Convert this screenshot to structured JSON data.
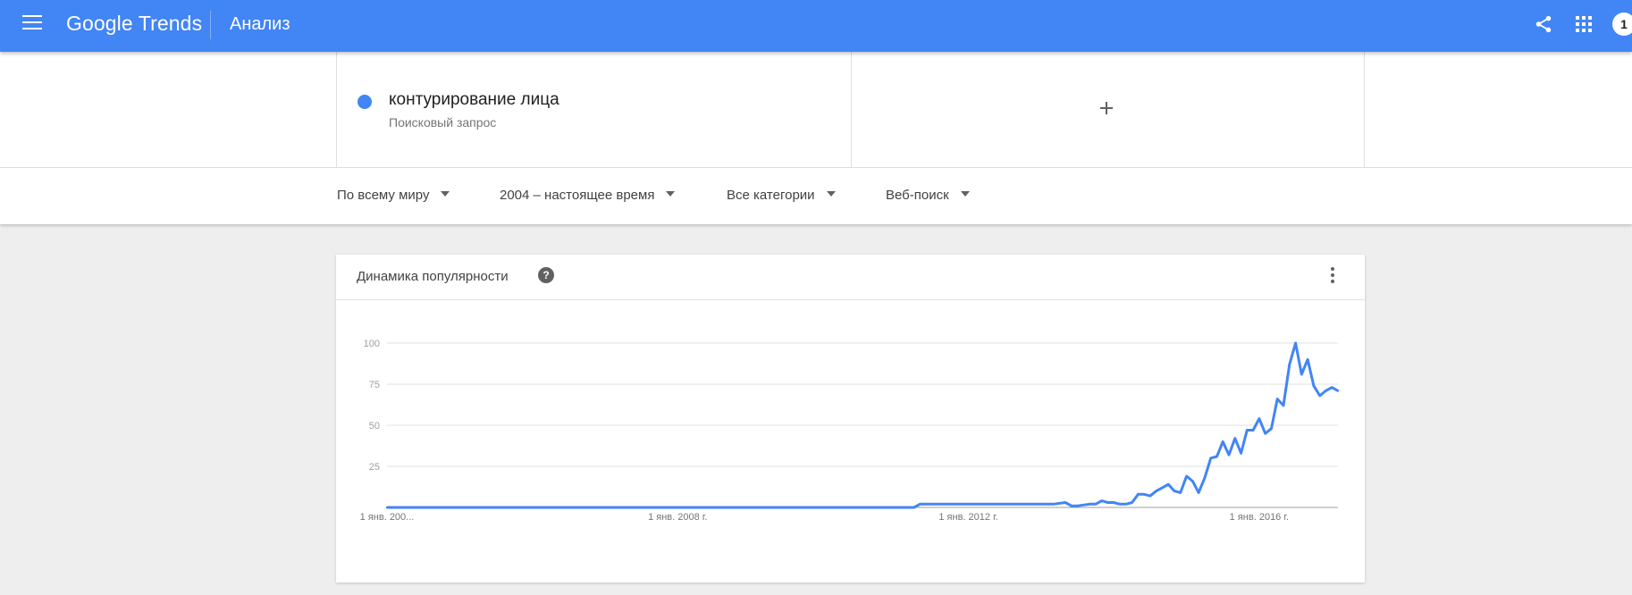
{
  "app": {
    "logo_text": "Google Trends",
    "page_title": "Анализ",
    "avatar_text": "1",
    "brand_color": "#4285f4"
  },
  "icons": {
    "menu": "menu-icon",
    "share": "share-icon",
    "apps": "apps-grid-icon",
    "add": "plus-icon",
    "help": "help-icon",
    "more": "more-vert-icon"
  },
  "terms": [
    {
      "name": "контурирование лица",
      "type": "Поисковый запрос",
      "color": "#4285f4"
    }
  ],
  "filters": {
    "region": "По всему миру",
    "period": "2004 – настоящее время",
    "category": "Все категории",
    "search_type": "Веб-поиск"
  },
  "chart_card": {
    "title": "Динамика популярности",
    "help_symbol": "?"
  },
  "chart_data": {
    "type": "line",
    "title": "Динамика популярности",
    "y_ticks": [
      "100",
      "75",
      "50",
      "25"
    ],
    "ylim": [
      0,
      100
    ],
    "x_tick_labels": [
      "1 янв. 200...",
      "1 янв. 2008 г.",
      "1 янв. 2012 г.",
      "1 янв. 2016 г."
    ],
    "x_tick_months": [
      0,
      48,
      96,
      144
    ],
    "xlim_months": [
      0,
      157
    ],
    "grid": true,
    "series": [
      {
        "color": "#4285f4",
        "points": [
          [
            0,
            0
          ],
          [
            10,
            0
          ],
          [
            20,
            0
          ],
          [
            30,
            0
          ],
          [
            40,
            0
          ],
          [
            50,
            0
          ],
          [
            60,
            0
          ],
          [
            70,
            0
          ],
          [
            80,
            0
          ],
          [
            87,
            0
          ],
          [
            88,
            2
          ],
          [
            90,
            2
          ],
          [
            95,
            2
          ],
          [
            100,
            2
          ],
          [
            105,
            2
          ],
          [
            110,
            2
          ],
          [
            112,
            3
          ],
          [
            113,
            1
          ],
          [
            114,
            1
          ],
          [
            116,
            2
          ],
          [
            117,
            2
          ],
          [
            118,
            4
          ],
          [
            119,
            3
          ],
          [
            120,
            3
          ],
          [
            121,
            2
          ],
          [
            122,
            2
          ],
          [
            123,
            3
          ],
          [
            124,
            8
          ],
          [
            125,
            8
          ],
          [
            126,
            7
          ],
          [
            127,
            10
          ],
          [
            128,
            12
          ],
          [
            129,
            14
          ],
          [
            130,
            10
          ],
          [
            131,
            9
          ],
          [
            132,
            19
          ],
          [
            133,
            16
          ],
          [
            134,
            9
          ],
          [
            135,
            18
          ],
          [
            136,
            30
          ],
          [
            137,
            31
          ],
          [
            138,
            40
          ],
          [
            139,
            32
          ],
          [
            140,
            42
          ],
          [
            141,
            33
          ],
          [
            142,
            47
          ],
          [
            143,
            47
          ],
          [
            144,
            54
          ],
          [
            145,
            45
          ],
          [
            146,
            48
          ],
          [
            147,
            66
          ],
          [
            148,
            62
          ],
          [
            149,
            87
          ],
          [
            150,
            100
          ],
          [
            151,
            81
          ],
          [
            152,
            90
          ],
          [
            153,
            74
          ],
          [
            154,
            68
          ],
          [
            155,
            71
          ],
          [
            156,
            73
          ],
          [
            157,
            71
          ]
        ]
      }
    ]
  }
}
